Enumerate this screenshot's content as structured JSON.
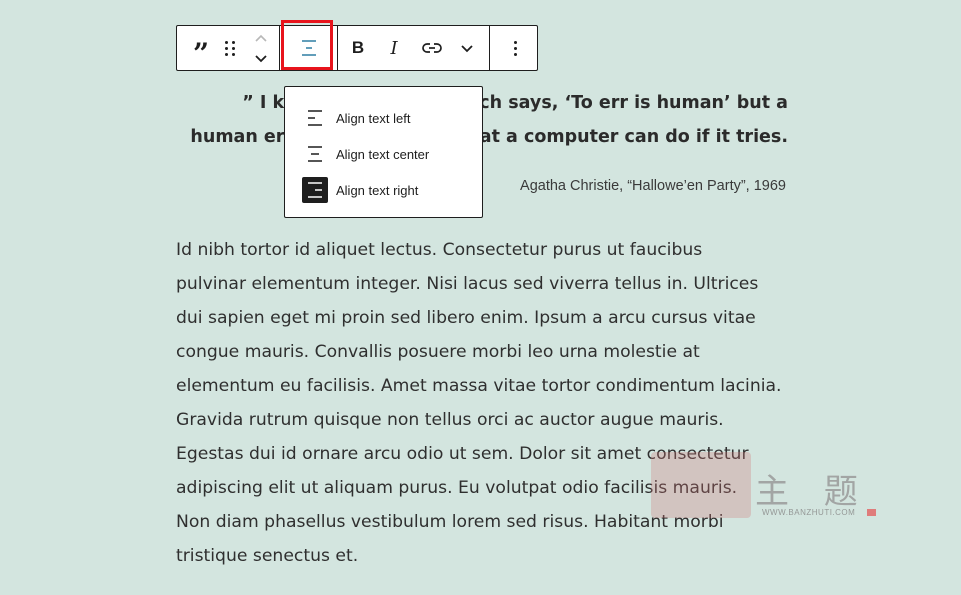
{
  "toolbar": {
    "buttons": [
      {
        "name": "quote-block-icon",
        "label": "Quote"
      },
      {
        "name": "drag-handle-icon",
        "label": "Drag"
      },
      {
        "name": "move-up-icon",
        "label": "Move up"
      },
      {
        "name": "move-down-icon",
        "label": "Move down"
      },
      {
        "name": "align-center-icon",
        "label": "Align text",
        "active": true
      },
      {
        "name": "bold-icon",
        "label": "Bold",
        "glyph": "B"
      },
      {
        "name": "italic-icon",
        "label": "Italic",
        "glyph": "I"
      },
      {
        "name": "link-icon",
        "label": "Link"
      },
      {
        "name": "more-chevron-icon",
        "label": "More"
      },
      {
        "name": "options-icon",
        "label": "Options"
      }
    ],
    "active_color": "#3b86a8",
    "highlight_color": "#e8141c"
  },
  "quote": {
    "line1": "” I know of a saying which says, ‘To err is human’ but a",
    "line2": "human error is nothing to what a computer can do if it tries.",
    "citation": "Agatha Christie, “Hallowe’en Party”, 1969"
  },
  "align_menu": {
    "items": [
      {
        "label": "Align text left",
        "icon": "align-left-icon"
      },
      {
        "label": "Align text center",
        "icon": "align-center-icon"
      },
      {
        "label": "Align text right",
        "icon": "align-right-icon",
        "active": true
      }
    ]
  },
  "body": {
    "lines": [
      "Id nibh tortor id aliquet lectus. Consectetur purus ut faucibus",
      "pulvinar elementum integer. Nisi lacus sed viverra tellus in. Ultrices",
      "dui sapien eget mi proin sed libero enim. Ipsum a arcu cursus vitae",
      "congue mauris. Convallis posuere morbi leo urna molestie at",
      "elementum eu facilisis. Amet massa vitae tortor condimentum lacinia.",
      "Gravida rutrum quisque non tellus orci ac auctor augue mauris.",
      "Egestas dui id ornare arcu odio ut sem. Dolor sit amet consectetur",
      "adipiscing elit ut aliquam purus. Eu volutpat odio facilisis mauris.",
      "Non diam phasellus vestibulum lorem sed risus. Habitant morbi",
      "tristique senectus et."
    ]
  },
  "watermark": {
    "chars": "主 题",
    "url": "WWW.BANZHUTI.COM"
  },
  "colors": {
    "background": "#d3e5df",
    "text": "#1e1e1e"
  }
}
